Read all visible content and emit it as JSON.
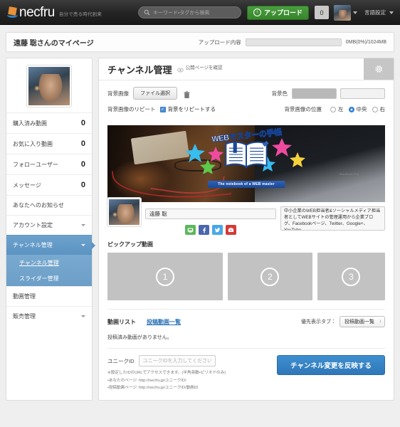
{
  "topnav": {
    "brand_name": "necfru",
    "brand_tagline": "自分で売る時代到来",
    "search_placeholder": "キーワード・タグから検索",
    "upload_label": "アップロード",
    "message_count": "0",
    "language_label": "言語設定"
  },
  "page_header": {
    "title": "遠藤 聡さんのマイページ",
    "upload_status_label": "アップロード内容",
    "upload_status_value": "0MB(0%)/1024MB",
    "upload_progress_percent": 0
  },
  "sidebar": {
    "stats": [
      {
        "label": "購入済み動画",
        "value": "0"
      },
      {
        "label": "お気に入り動画",
        "value": "0"
      },
      {
        "label": "フォローユーザー",
        "value": "0"
      },
      {
        "label": "メッセージ",
        "value": "0"
      }
    ],
    "items": [
      {
        "label": "あなたへのお知らせ",
        "has_caret": false,
        "active": false
      },
      {
        "label": "アカウント設定",
        "has_caret": true,
        "active": false
      },
      {
        "label": "チャンネル管理",
        "has_caret": true,
        "active": true
      },
      {
        "label": "動画管理",
        "has_caret": false,
        "active": false
      },
      {
        "label": "販売管理",
        "has_caret": true,
        "active": false
      }
    ],
    "subitems": [
      {
        "label": "チャンネル管理",
        "current": true
      },
      {
        "label": "スライダー管理",
        "current": false
      }
    ]
  },
  "main": {
    "title": "チャンネル管理",
    "public_link_label": "公開ページを確認",
    "form": {
      "bg_image_label": "背景画像",
      "file_button_label": "ファイル選択",
      "bg_color_label": "背景色",
      "bg_color_value": "#b8b8b8",
      "bg_color_secondary_value": "",
      "repeat_label": "背景画像のリピート",
      "repeat_checkbox_label": "背景をリピートする",
      "repeat_checked": true,
      "position_label": "背景画像の位置",
      "position_options": [
        {
          "label": "左",
          "selected": false
        },
        {
          "label": "中央",
          "selected": true
        },
        {
          "label": "右",
          "selected": false
        }
      ]
    },
    "banner": {
      "title": "WEBマスターの手帳",
      "ribbon": "The notebook of a  WEB master",
      "laptop_brand": "MacBook Pro"
    },
    "profile": {
      "name_value": "遠藤 聡",
      "description_value": "中小企業のWEB担当者&ソーシャルメディア担当者としてWEBサイトの管理運用から企業ブログ、Facebookページ、Twitter、Google+、YouTube",
      "social": [
        {
          "name": "line",
          "color": "#5cb85c"
        },
        {
          "name": "facebook",
          "color": "#4a68ad"
        },
        {
          "name": "twitter",
          "color": "#49a8e8"
        },
        {
          "name": "youtube",
          "color": "#d33b38"
        }
      ]
    },
    "pickup": {
      "section_label": "ピックアップ動画",
      "slots": [
        "1",
        "2",
        "3"
      ]
    },
    "video_list": {
      "label": "動画リスト",
      "tab_link": "投稿動画一覧",
      "priority_tab_label": "優先表示タブ：",
      "priority_tab_value": "投稿動画一覧",
      "empty_message": "投稿済み動画がありません。"
    },
    "unique_id": {
      "label": "ユニークID",
      "placeholder": "ユニークIDを入力してください。",
      "value": "",
      "note1": "※設定したIDのURLでアクセスできます。(半角英数・ピリオドのみ)",
      "note2": "・あなたのページ: http://necfru.jp/ユニークID/",
      "note3": "・投稿動画ページ: http://necfru.jp/ユニークID/動画ID"
    },
    "submit_label": "チャンネル変更を反映する"
  }
}
